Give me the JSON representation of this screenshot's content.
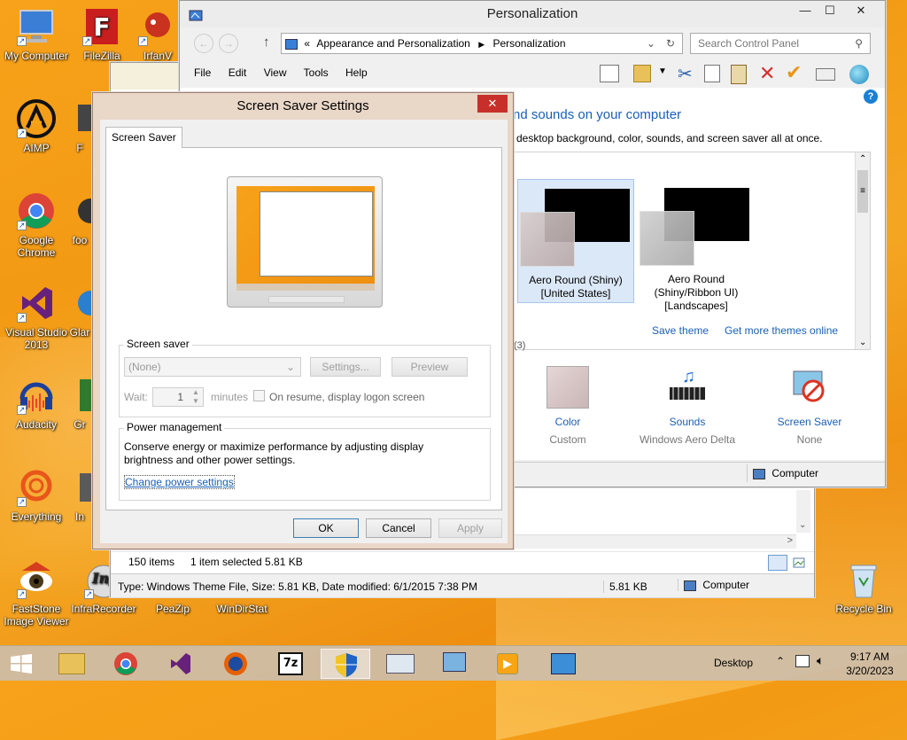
{
  "desktop": {
    "icons": [
      {
        "label": "My Computer"
      },
      {
        "label": "FileZilla"
      },
      {
        "label": "IrfanV"
      },
      {
        "label": "AIMP"
      },
      {
        "label": "F"
      },
      {
        "label": "Google Chrome"
      },
      {
        "label": "foo"
      },
      {
        "label": "Visual Studio 2013"
      },
      {
        "label": "Glar"
      },
      {
        "label": "Audacity"
      },
      {
        "label": "Gr"
      },
      {
        "label": "Everything"
      },
      {
        "label": "In"
      },
      {
        "label": "FastStone Image Viewer"
      },
      {
        "label": "InfraRecorder"
      },
      {
        "label": "PeaZip"
      },
      {
        "label": "WinDirStat"
      },
      {
        "label": "Recycle Bin"
      }
    ]
  },
  "personalization": {
    "title": "Personalization",
    "address": {
      "prefix": "«",
      "crumb1": "Appearance and Personalization",
      "crumb2": "Personalization"
    },
    "search_placeholder": "Search Control Panel",
    "menu": [
      "File",
      "Edit",
      "View",
      "Tools",
      "Help"
    ],
    "heading": "nd sounds on your computer",
    "subheading": "desktop background, color, sounds, and screen saver all at once.",
    "themes": [
      {
        "name_line1": "Aero Round (Shiny)",
        "name_line2": "[United States]",
        "name_line3": ""
      },
      {
        "name_line1": "Aero Round",
        "name_line2": "(Shiny/Ribbon UI)",
        "name_line3": "[Landscapes]"
      }
    ],
    "save_theme": "Save theme",
    "get_more": "Get more themes online",
    "count_fragment": "(3)",
    "bottom_items": [
      {
        "label": "Color",
        "sub": "Custom",
        "icon": "color-swatch-icon"
      },
      {
        "label": "Sounds",
        "sub": "Windows Aero Delta",
        "icon": "sounds-icon"
      },
      {
        "label": "Screen Saver",
        "sub": "None",
        "icon": "screen-saver-icon"
      }
    ],
    "status_computer": "Computer"
  },
  "explorer": {
    "items_count": "150 items",
    "selected": "1 item selected  5.81 KB",
    "status_type": "Type: Windows Theme File, Size: 5.81 KB, Date modified: 6/1/2015 7:38 PM",
    "status_size": "5.81 KB",
    "status_location": "Computer"
  },
  "dialog": {
    "title": "Screen Saver Settings",
    "close": "✕",
    "tab": "Screen Saver",
    "screensaver_group": "Screen saver",
    "screensaver_value": "(None)",
    "settings_btn": "Settings...",
    "preview_btn": "Preview",
    "wait_label": "Wait:",
    "wait_value": "1",
    "minutes": "minutes",
    "resume_label": "On resume, display logon screen",
    "power_group": "Power management",
    "power_text": "Conserve energy or maximize performance by adjusting display brightness and other power settings.",
    "power_link": "Change power settings",
    "ok": "OK",
    "cancel": "Cancel",
    "apply": "Apply"
  },
  "taskbar": {
    "desktop_label": "Desktop",
    "time": "9:17 AM",
    "date": "3/20/2023"
  }
}
